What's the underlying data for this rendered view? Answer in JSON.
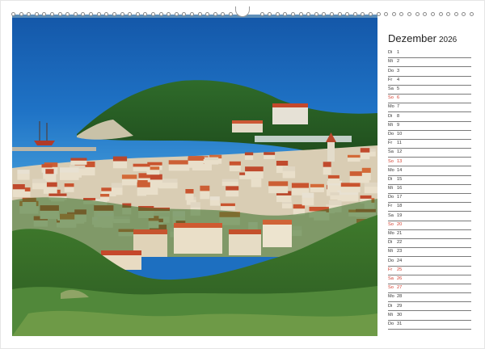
{
  "calendar": {
    "month": "Dezember",
    "year": "2026",
    "days": [
      {
        "weekday": "Di",
        "day": "1",
        "type": "normal"
      },
      {
        "weekday": "Mi",
        "day": "2",
        "type": "normal"
      },
      {
        "weekday": "Do",
        "day": "3",
        "type": "normal"
      },
      {
        "weekday": "Fr",
        "day": "4",
        "type": "normal"
      },
      {
        "weekday": "Sa",
        "day": "5",
        "type": "normal"
      },
      {
        "weekday": "So",
        "day": "6",
        "type": "sunday"
      },
      {
        "weekday": "Mo",
        "day": "7",
        "type": "normal"
      },
      {
        "weekday": "Di",
        "day": "8",
        "type": "normal"
      },
      {
        "weekday": "Mi",
        "day": "9",
        "type": "normal"
      },
      {
        "weekday": "Do",
        "day": "10",
        "type": "normal"
      },
      {
        "weekday": "Fr",
        "day": "11",
        "type": "normal"
      },
      {
        "weekday": "Sa",
        "day": "12",
        "type": "normal"
      },
      {
        "weekday": "So",
        "day": "13",
        "type": "sunday"
      },
      {
        "weekday": "Mo",
        "day": "14",
        "type": "normal"
      },
      {
        "weekday": "Di",
        "day": "15",
        "type": "normal"
      },
      {
        "weekday": "Mi",
        "day": "16",
        "type": "normal"
      },
      {
        "weekday": "Do",
        "day": "17",
        "type": "normal"
      },
      {
        "weekday": "Fr",
        "day": "18",
        "type": "normal"
      },
      {
        "weekday": "Sa",
        "day": "19",
        "type": "normal"
      },
      {
        "weekday": "So",
        "day": "20",
        "type": "sunday"
      },
      {
        "weekday": "Mo",
        "day": "21",
        "type": "normal"
      },
      {
        "weekday": "Di",
        "day": "22",
        "type": "normal"
      },
      {
        "weekday": "Mi",
        "day": "23",
        "type": "normal"
      },
      {
        "weekday": "Do",
        "day": "24",
        "type": "normal"
      },
      {
        "weekday": "Fr",
        "day": "25",
        "type": "holiday"
      },
      {
        "weekday": "Sa",
        "day": "26",
        "type": "holiday"
      },
      {
        "weekday": "So",
        "day": "27",
        "type": "sunday"
      },
      {
        "weekday": "Mo",
        "day": "28",
        "type": "normal"
      },
      {
        "weekday": "Di",
        "day": "29",
        "type": "normal"
      },
      {
        "weekday": "Mi",
        "day": "30",
        "type": "normal"
      },
      {
        "weekday": "Do",
        "day": "31",
        "type": "normal"
      }
    ]
  },
  "colors": {
    "sunday_holiday": "#d23a2a",
    "text": "#333333",
    "rule": "#7a7a7a",
    "sea": "#1d6fc0"
  },
  "photo": {
    "icon": "coastal-town-photo"
  }
}
